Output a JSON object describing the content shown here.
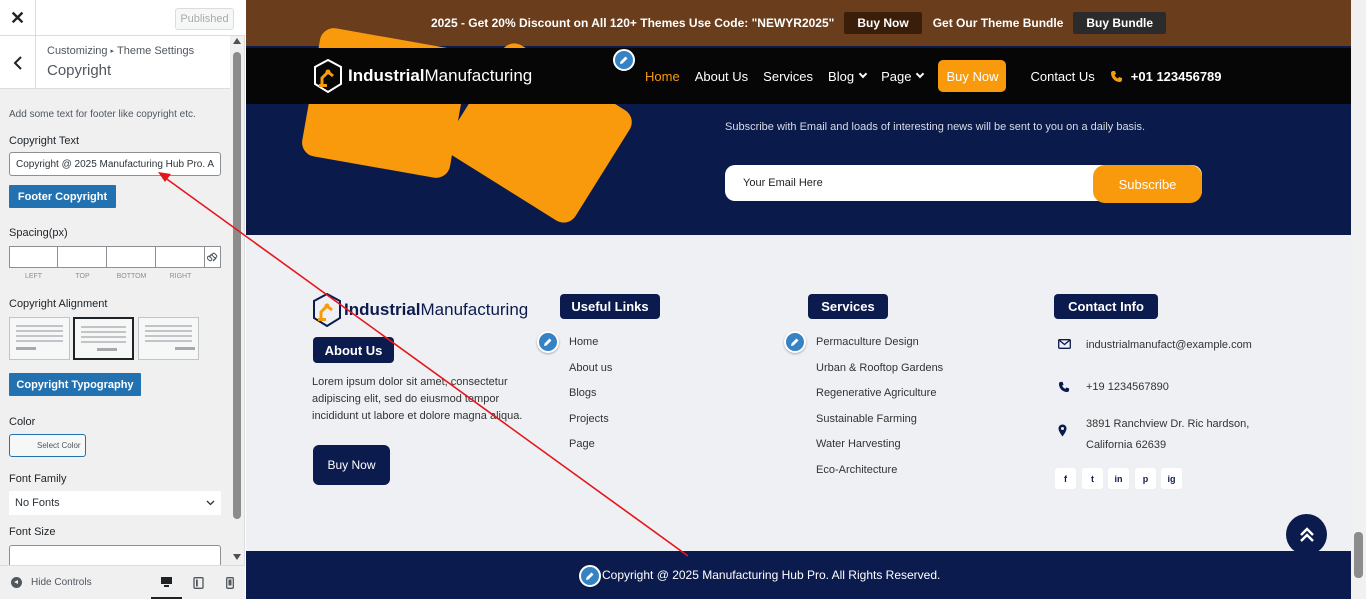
{
  "sidebar": {
    "close_icon": "close-icon",
    "published_label": "Published",
    "breadcrumb_root": "Customizing",
    "breadcrumb_sep": "▸",
    "breadcrumb_parent": "Theme Settings",
    "section_title": "Copyright",
    "description": "Add some text for footer like copyright etc.",
    "copyright_text_label": "Copyright Text",
    "copyright_text_value": "Copyright @ 2025 Manufacturing Hub Pro. All Rights Reserved.",
    "footer_copyright_button": "Footer Copyright",
    "spacing_label": "Spacing(px)",
    "spacing_fields": [
      "LEFT",
      "TOP",
      "BOTTOM",
      "RIGHT"
    ],
    "alignment_label": "Copyright Alignment",
    "alignment_options": [
      "left",
      "center",
      "right"
    ],
    "alignment_selected": "center",
    "typography_button": "Copyright Typography",
    "color_label": "Color",
    "select_color": "Select Color",
    "font_family_label": "Font Family",
    "font_family_value": "No Fonts",
    "font_size_label": "Font Size",
    "hide_controls": "Hide Controls",
    "devices": [
      "desktop",
      "tablet",
      "mobile"
    ],
    "device_selected": "desktop",
    "accent_color": "#2271b1"
  },
  "preview": {
    "promo": {
      "text": "2025 - Get 20% Discount on All 120+ Themes Use Code: \"NEWYR2025\"",
      "buy_now": "Buy Now",
      "bundle_text": "Get Our Theme Bundle",
      "buy_bundle": "Buy Bundle"
    },
    "logo": {
      "bold": "Industrial",
      "regular": "Manufacturing"
    },
    "nav": {
      "items": [
        "Home",
        "About Us",
        "Services",
        "Blog",
        "Page"
      ],
      "active": "Home",
      "buy_now": "Buy Now",
      "contact": "Contact Us",
      "phone": "+01 123456789"
    },
    "newsletter": {
      "subtitle": "Subscribe with Email and loads of interesting news will be sent to you on a daily basis.",
      "email_placeholder": "Your Email Here",
      "subscribe": "Subscribe"
    },
    "footer": {
      "about_title": "About Us",
      "about_text": "Lorem ipsum dolor sit amet, consectetur adipiscing elit, sed do eiusmod tempor incididunt ut labore et dolore magna aliqua.",
      "buy_now": "Buy Now",
      "useful_links_title": "Useful Links",
      "useful_links": [
        "Home",
        "About us",
        "Blogs",
        "Projects",
        "Page"
      ],
      "services_title": "Services",
      "services": [
        "Permaculture Design",
        "Urban & Rooftop Gardens",
        "Regenerative Agriculture",
        "Sustainable Farming",
        "Water Harvesting",
        "Eco-Architecture"
      ],
      "contact_title": "Contact Info",
      "email": "industrialmanufact@example.com",
      "phone": "+19 1234567890",
      "address_line1": "3891 Ranchview Dr. Ric hardson,",
      "address_line2": "California 62639",
      "social": [
        "f",
        "t",
        "in",
        "p",
        "ig"
      ],
      "copyright": "Copyright @ 2025 Manufacturing Hub Pro. All Rights Reserved."
    },
    "colors": {
      "navy": "#0c1b4e",
      "orange": "#f89a0c",
      "brown": "#6a3d1c"
    }
  }
}
